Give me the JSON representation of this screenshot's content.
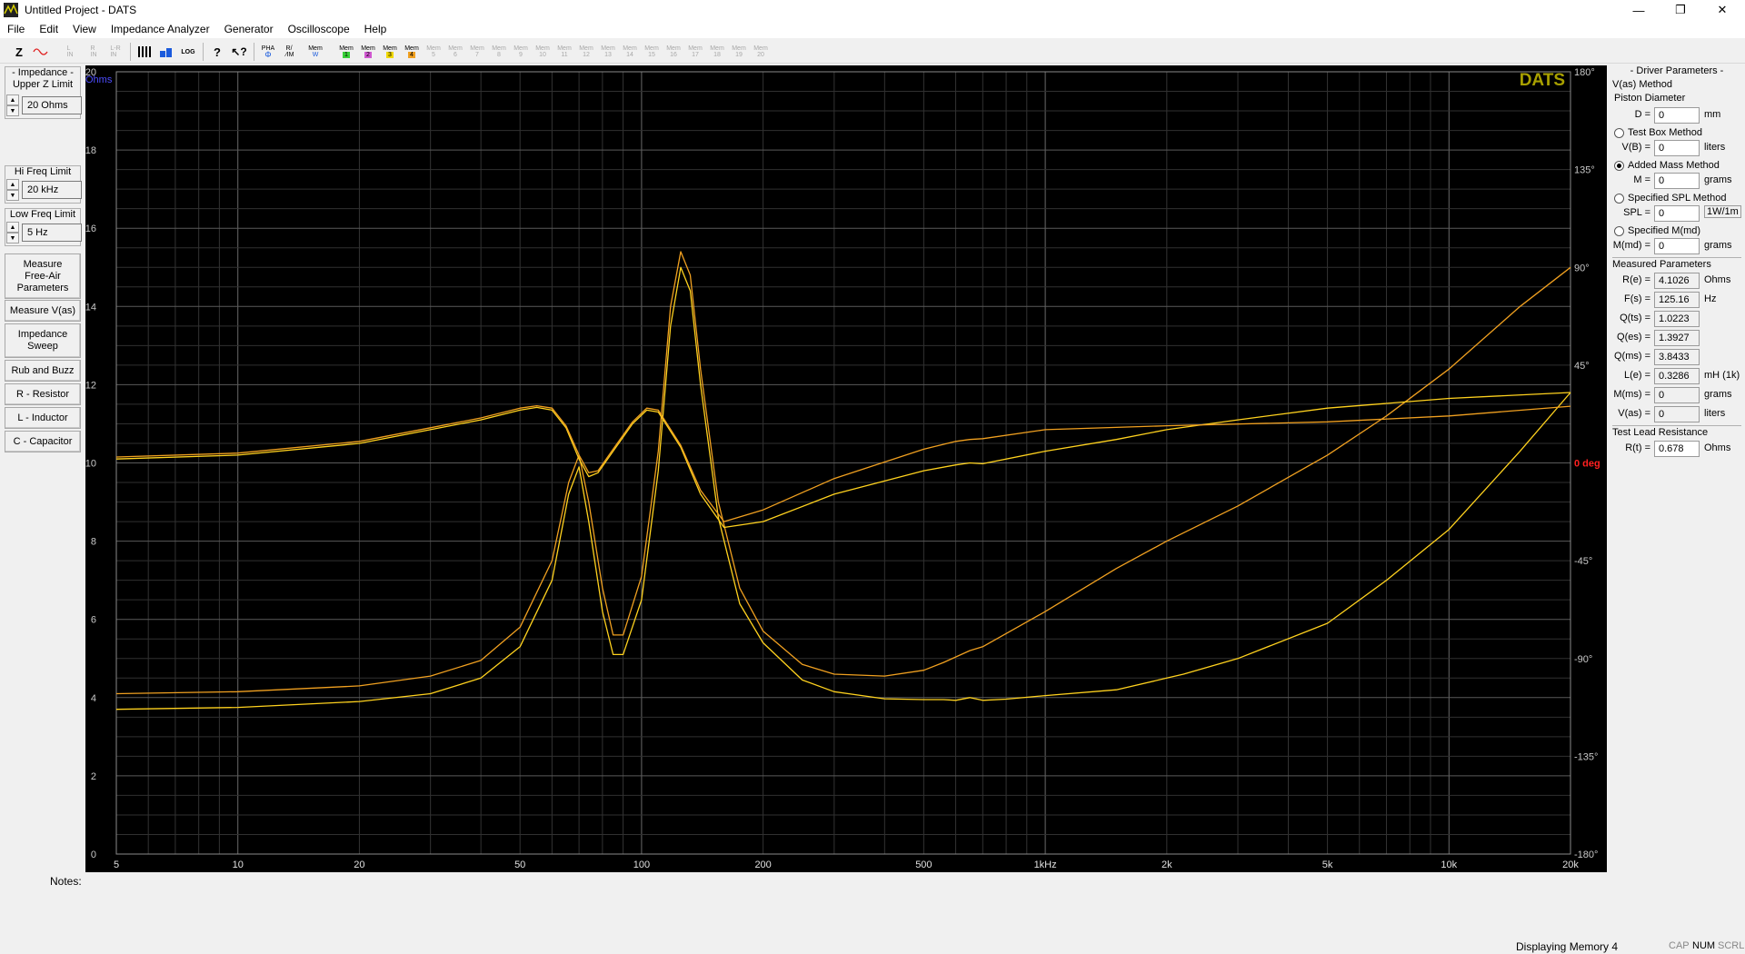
{
  "window": {
    "title": "Untitled Project - DATS",
    "controls": {
      "minimize": "—",
      "maximize": "❐",
      "close": "✕"
    }
  },
  "menu": [
    "File",
    "Edit",
    "View",
    "Impedance Analyzer",
    "Generator",
    "Oscilloscope",
    "Help"
  ],
  "toolbar": {
    "mem_label": "Mem",
    "pha_label": "PHA",
    "w_label": "W",
    "mem_numbers": [
      "1",
      "2",
      "3",
      "4",
      "5",
      "6",
      "7",
      "8",
      "9",
      "10",
      "11",
      "12",
      "13",
      "14",
      "15",
      "16",
      "17",
      "18",
      "19",
      "20"
    ]
  },
  "left_panel": {
    "impedance_group": {
      "label": "- Impedance -\nUpper Z Limit",
      "value": "20 Ohms"
    },
    "hi_freq_group": {
      "label": "Hi Freq Limit",
      "value": "20 kHz"
    },
    "low_freq_group": {
      "label": "Low Freq Limit",
      "value": "5 Hz"
    },
    "buttons": {
      "measure_free_air": "Measure\nFree-Air\nParameters",
      "measure_vas": "Measure V(as)",
      "impedance_sweep": "Impedance\nSweep",
      "rub_and_buzz": "Rub and Buzz",
      "r_resistor": "R - Resistor",
      "l_inductor": "L - Inductor",
      "c_capacitor": "C - Capacitor"
    }
  },
  "chart_data": {
    "type": "line",
    "xscale": "log",
    "xlim": [
      5,
      20000
    ],
    "x_tick_labels": [
      "5",
      "10",
      "20",
      "50",
      "100",
      "200",
      "500",
      "1kHz",
      "2k",
      "5k",
      "10k",
      "20k"
    ],
    "x_tick_values": [
      5,
      10,
      20,
      50,
      100,
      200,
      500,
      1000,
      2000,
      5000,
      10000,
      20000
    ],
    "ylim": [
      0,
      20
    ],
    "y_ticks": [
      0,
      2,
      4,
      6,
      8,
      10,
      12,
      14,
      16,
      18,
      20
    ],
    "y_unit": "Ohms",
    "y2lim": [
      -180,
      180
    ],
    "y2_ticks": [
      180,
      135,
      90,
      45,
      0,
      -45,
      -90,
      -135,
      -180
    ],
    "y2_tick_labels": [
      "180°",
      "135°",
      "90°",
      "45°",
      "0 deg",
      "-45°",
      "-90°",
      "-135°",
      "-180°"
    ],
    "y2_zero_label_color": "#ff2020",
    "y_unit_color": "#4d4dff",
    "grid": true,
    "brand_text": "DATS",
    "brand_color": "#a8a000",
    "series": [
      {
        "kind": "impedance",
        "color": "#ffd21e",
        "points": [
          [
            5,
            3.7
          ],
          [
            10,
            3.75
          ],
          [
            20,
            3.9
          ],
          [
            30,
            4.1
          ],
          [
            40,
            4.5
          ],
          [
            50,
            5.3
          ],
          [
            60,
            7.0
          ],
          [
            66,
            9.2
          ],
          [
            70,
            9.9
          ],
          [
            74,
            8.5
          ],
          [
            80,
            6.2
          ],
          [
            85,
            5.1
          ],
          [
            90,
            5.1
          ],
          [
            100,
            6.5
          ],
          [
            110,
            9.8
          ],
          [
            118,
            13.5
          ],
          [
            125,
            15.0
          ],
          [
            132,
            14.4
          ],
          [
            140,
            12.0
          ],
          [
            155,
            8.6
          ],
          [
            175,
            6.4
          ],
          [
            200,
            5.4
          ],
          [
            250,
            4.45
          ],
          [
            300,
            4.15
          ],
          [
            400,
            3.97
          ],
          [
            500,
            3.95
          ],
          [
            560,
            3.95
          ],
          [
            600,
            3.93
          ],
          [
            650,
            4.0
          ],
          [
            700,
            3.93
          ],
          [
            800,
            3.96
          ],
          [
            1000,
            4.05
          ],
          [
            1500,
            4.2
          ],
          [
            2000,
            4.5
          ],
          [
            2200,
            4.6
          ],
          [
            3000,
            5.0
          ],
          [
            5000,
            5.9
          ],
          [
            7000,
            7.0
          ],
          [
            10000,
            8.3
          ],
          [
            15000,
            10.3
          ],
          [
            20000,
            11.8
          ]
        ]
      },
      {
        "kind": "impedance",
        "color": "#f0a020",
        "points": [
          [
            5,
            4.1
          ],
          [
            10,
            4.15
          ],
          [
            20,
            4.3
          ],
          [
            30,
            4.55
          ],
          [
            40,
            4.95
          ],
          [
            50,
            5.8
          ],
          [
            60,
            7.5
          ],
          [
            66,
            9.5
          ],
          [
            70,
            10.2
          ],
          [
            74,
            9.0
          ],
          [
            80,
            6.8
          ],
          [
            85,
            5.6
          ],
          [
            90,
            5.6
          ],
          [
            100,
            7.1
          ],
          [
            110,
            10.3
          ],
          [
            118,
            14.0
          ],
          [
            125,
            15.4
          ],
          [
            132,
            14.8
          ],
          [
            140,
            12.4
          ],
          [
            155,
            9.0
          ],
          [
            175,
            6.8
          ],
          [
            200,
            5.7
          ],
          [
            250,
            4.85
          ],
          [
            300,
            4.6
          ],
          [
            400,
            4.55
          ],
          [
            500,
            4.7
          ],
          [
            560,
            4.9
          ],
          [
            650,
            5.2
          ],
          [
            700,
            5.3
          ],
          [
            1000,
            6.2
          ],
          [
            1500,
            7.3
          ],
          [
            2000,
            8.0
          ],
          [
            3000,
            8.9
          ],
          [
            5000,
            10.2
          ],
          [
            7000,
            11.2
          ],
          [
            10000,
            12.4
          ],
          [
            15000,
            14.0
          ],
          [
            20000,
            15.0
          ]
        ]
      },
      {
        "kind": "phase",
        "color": "#ffd21e",
        "points": [
          [
            5,
            10.1
          ],
          [
            10,
            10.2
          ],
          [
            20,
            10.5
          ],
          [
            30,
            10.85
          ],
          [
            40,
            11.1
          ],
          [
            50,
            11.35
          ],
          [
            55,
            11.42
          ],
          [
            60,
            11.35
          ],
          [
            65,
            10.9
          ],
          [
            70,
            10.1
          ],
          [
            74,
            9.65
          ],
          [
            78,
            9.75
          ],
          [
            85,
            10.3
          ],
          [
            95,
            11.0
          ],
          [
            103,
            11.35
          ],
          [
            110,
            11.3
          ],
          [
            125,
            10.4
          ],
          [
            140,
            9.2
          ],
          [
            160,
            8.35
          ],
          [
            200,
            8.5
          ],
          [
            300,
            9.2
          ],
          [
            500,
            9.8
          ],
          [
            600,
            9.95
          ],
          [
            650,
            10.0
          ],
          [
            700,
            9.98
          ],
          [
            1000,
            10.3
          ],
          [
            1500,
            10.6
          ],
          [
            2000,
            10.85
          ],
          [
            3000,
            11.1
          ],
          [
            5000,
            11.4
          ],
          [
            10000,
            11.65
          ],
          [
            20000,
            11.8
          ]
        ]
      },
      {
        "kind": "phase",
        "color": "#f0a020",
        "points": [
          [
            5,
            10.15
          ],
          [
            10,
            10.25
          ],
          [
            20,
            10.55
          ],
          [
            30,
            10.9
          ],
          [
            40,
            11.15
          ],
          [
            50,
            11.4
          ],
          [
            55,
            11.46
          ],
          [
            60,
            11.4
          ],
          [
            65,
            10.95
          ],
          [
            70,
            10.2
          ],
          [
            74,
            9.75
          ],
          [
            78,
            9.8
          ],
          [
            85,
            10.35
          ],
          [
            95,
            11.05
          ],
          [
            103,
            11.4
          ],
          [
            110,
            11.35
          ],
          [
            125,
            10.45
          ],
          [
            140,
            9.3
          ],
          [
            160,
            8.5
          ],
          [
            200,
            8.8
          ],
          [
            300,
            9.6
          ],
          [
            500,
            10.35
          ],
          [
            600,
            10.55
          ],
          [
            650,
            10.6
          ],
          [
            700,
            10.62
          ],
          [
            1000,
            10.85
          ],
          [
            2000,
            10.95
          ],
          [
            5000,
            11.05
          ],
          [
            10000,
            11.2
          ],
          [
            20000,
            11.45
          ]
        ]
      }
    ]
  },
  "right_panel": {
    "driver_parameters_title": "- Driver Parameters -",
    "vas_method": "V(as) Method",
    "piston_diameter": "Piston Diameter",
    "d_label": "D =",
    "d_value": "0",
    "d_unit": "mm",
    "test_box_method": "Test Box Method",
    "vb_label": "V(B) =",
    "vb_value": "0",
    "vb_unit": "liters",
    "added_mass_method": "Added Mass Method",
    "m_label": "M =",
    "m_value": "0",
    "m_unit": "grams",
    "specified_spl_method": "Specified SPL Method",
    "spl_label": "SPL =",
    "spl_value": "0",
    "spl_unit": "1W/1m",
    "specified_mmd": "Specified M(md)",
    "mmd_label": "M(md) =",
    "mmd_value": "0",
    "mmd_unit": "grams",
    "measured_title": "Measured Parameters",
    "re_label": "R(e) =",
    "re_value": "4.1026",
    "re_unit": "Ohms",
    "fs_label": "F(s) =",
    "fs_value": "125.16",
    "fs_unit": "Hz",
    "qts_label": "Q(ts) =",
    "qts_value": "1.0223",
    "qes_label": "Q(es) =",
    "qes_value": "1.3927",
    "qms_label": "Q(ms) =",
    "qms_value": "3.8433",
    "le_label": "L(e) =",
    "le_value": "0.3286",
    "le_unit": "mH (1k)",
    "mms_label": "M(ms) =",
    "mms_value": "0",
    "mms_unit": "grams",
    "vas_label": "V(as) =",
    "vas_value": "0",
    "vas_unit": "liters",
    "test_lead_title": "Test Lead Resistance",
    "rt_label": "R(t) =",
    "rt_value": "0.678",
    "rt_unit": "Ohms"
  },
  "notes_label": "Notes:",
  "status": {
    "text": "Displaying Memory 4",
    "cap": "CAP",
    "num": "NUM",
    "scrl": "SCRL"
  }
}
